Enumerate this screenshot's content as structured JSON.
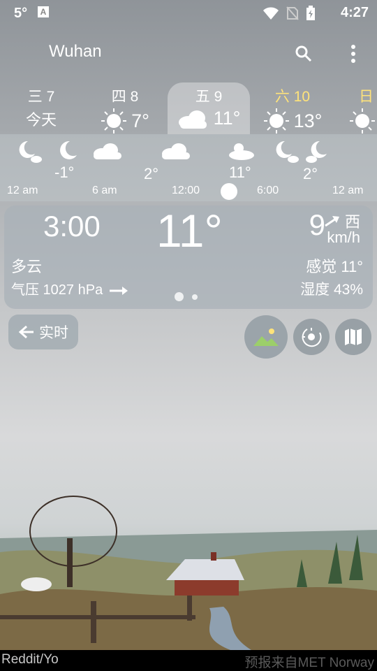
{
  "status": {
    "temp": "5°",
    "time": "4:27"
  },
  "appbar": {
    "city": "Wuhan"
  },
  "days": [
    {
      "weekday": "三 7",
      "sub": "今天",
      "temp": ""
    },
    {
      "weekday": "四 8",
      "sub": "",
      "temp": "7°"
    },
    {
      "weekday": "五 9",
      "sub": "",
      "temp": "11°"
    },
    {
      "weekday": "六 10",
      "sub": "",
      "temp": "13°"
    },
    {
      "weekday": "日",
      "sub": "",
      "temp": ""
    }
  ],
  "hourly": {
    "temps": [
      "-1°",
      "2°",
      "11°",
      "2°"
    ],
    "times": [
      "12 am",
      "6 am",
      "12:00",
      "6:00",
      "12 am"
    ],
    "icons": [
      "moon-cloud",
      "moon",
      "cloud",
      "cloud",
      "sun-cloud",
      "moon-cloud",
      "moon-cloud"
    ]
  },
  "current": {
    "time": "3:00",
    "temp": "11°",
    "wind_speed": "9",
    "wind_dir": "西",
    "wind_unit": "km/h",
    "condition": "多云",
    "pressure": "气压 1027 hPa",
    "feels_like": "感觉 11°",
    "humidity": "湿度 43%"
  },
  "controls": {
    "live_label": "实时"
  },
  "footer": {
    "left": "Reddit/Yo",
    "right": "预报来自MET Norway"
  },
  "colors": {
    "highlight": "#ffe37a",
    "background": "#9aa0a6"
  }
}
